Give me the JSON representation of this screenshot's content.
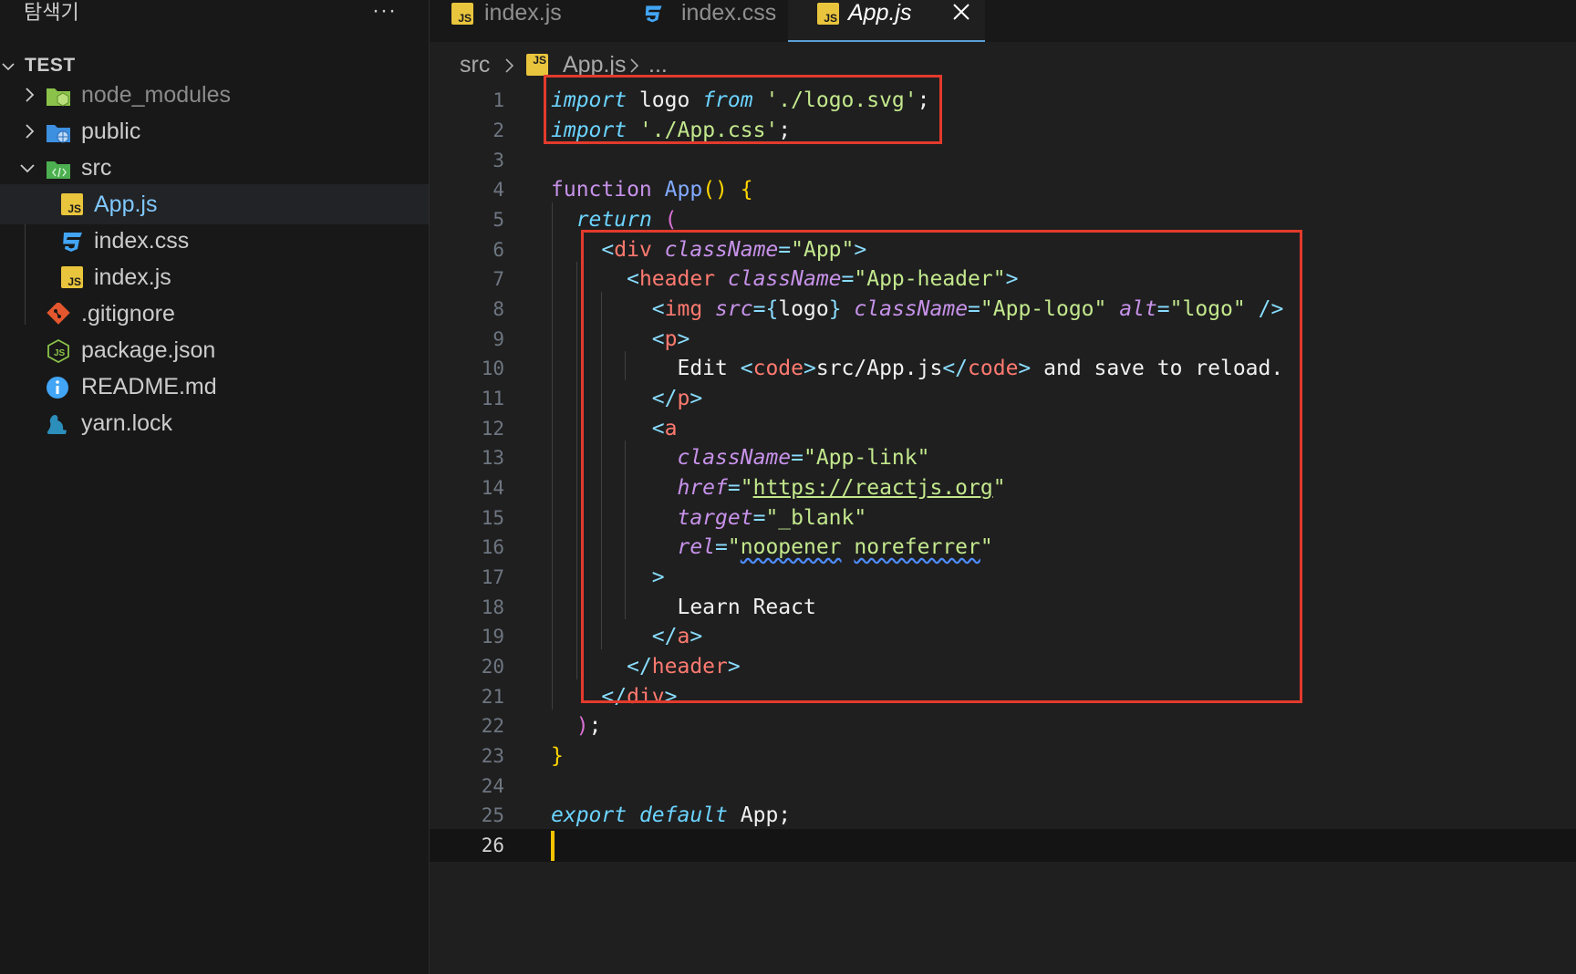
{
  "sidebar": {
    "title": "탐색기",
    "more_label": "···",
    "project": "TEST",
    "items": [
      {
        "label": "node_modules",
        "icon": "node-modules-folder-icon",
        "chevron": "chevron-right-icon"
      },
      {
        "label": "public",
        "icon": "public-folder-icon",
        "chevron": "chevron-right-icon"
      },
      {
        "label": "src",
        "icon": "src-folder-icon",
        "chevron": "chevron-down-icon"
      },
      {
        "label": "App.js",
        "icon": "js-file-icon"
      },
      {
        "label": "index.css",
        "icon": "css-file-icon"
      },
      {
        "label": "index.js",
        "icon": "js-file-icon"
      },
      {
        "label": ".gitignore",
        "icon": "git-icon"
      },
      {
        "label": "package.json",
        "icon": "nodejs-icon"
      },
      {
        "label": "README.md",
        "icon": "info-icon"
      },
      {
        "label": "yarn.lock",
        "icon": "yarn-icon"
      }
    ]
  },
  "tabs": [
    {
      "label": "index.js",
      "icon": "js-file-icon"
    },
    {
      "label": "index.css",
      "icon": "css-file-icon"
    },
    {
      "label": "App.js",
      "icon": "js-file-icon",
      "active": true
    }
  ],
  "breadcrumb": {
    "folder": "src",
    "file": "App.js",
    "ellipsis": "..."
  },
  "js_badge_text": "JS",
  "editor": {
    "line_numbers": [
      "1",
      "2",
      "3",
      "4",
      "5",
      "6",
      "7",
      "8",
      "9",
      "10",
      "11",
      "12",
      "13",
      "14",
      "15",
      "16",
      "17",
      "18",
      "19",
      "20",
      "21",
      "22",
      "23",
      "24",
      "25",
      "26"
    ],
    "current_line": 26,
    "tokens": {
      "import": "import",
      "logo": "logo",
      "from": "from",
      "logo_path": "'./logo.svg'",
      "semi": ";",
      "css_path": "'./App.css'",
      "function": "function",
      "app": "App",
      "paren_open": "(",
      "paren_close": ")",
      "paren_pair": "()",
      "brace_open": "{",
      "brace_close": "}",
      "return": "return",
      "lt": "<",
      "lt_slash": "</",
      "gt": ">",
      "self_close": " />",
      "eq": "=",
      "div": "div",
      "header": "header",
      "img": "img",
      "p": "p",
      "a": "a",
      "code": "code",
      "className": "className",
      "src": "src",
      "alt": "alt",
      "href": "href",
      "target": "target",
      "rel": "rel",
      "app_str": "\"App\"",
      "app_header_str": "\"App-header\"",
      "app_logo_str": "\"App-logo\"",
      "logo_str": "\"logo\"",
      "app_link_str": "\"App-link\"",
      "quote": "\"",
      "url": "https://reactjs.org",
      "blank_str": "\"_blank\"",
      "noopener": "noopener",
      "noreferrer": "noreferrer",
      "edit": "Edit ",
      "src_app_js": "src/App.js",
      "save_reload": " and save to reload.",
      "learn_react": "Learn React",
      "close_paren_semi_paren": ")",
      "export": "export",
      "default": "default",
      "app_semi": "App;"
    }
  },
  "colors": {
    "highlight_box": "#e33a2c",
    "cursor": "#f2c300",
    "active_tab_border": "#5a9fd6"
  }
}
